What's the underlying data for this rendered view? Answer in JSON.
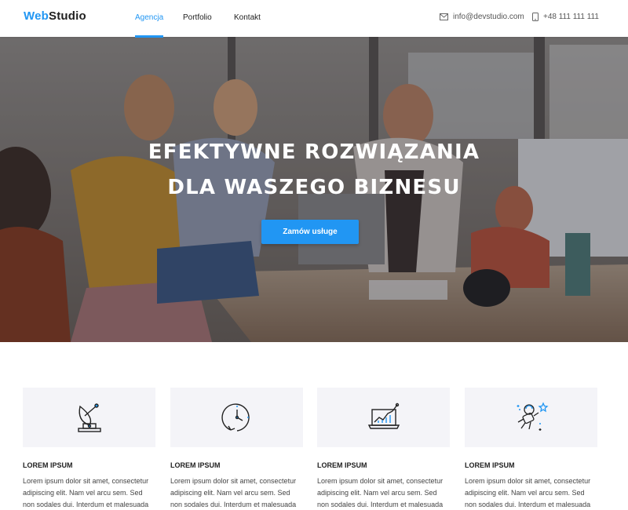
{
  "header": {
    "logo_part1": "Web",
    "logo_part2": "Studio",
    "nav": [
      {
        "label": "Agencja",
        "active": true
      },
      {
        "label": "Portfolio",
        "active": false
      },
      {
        "label": "Kontakt",
        "active": false
      }
    ],
    "email": "info@devstudio.com",
    "phone": "+48 111 111 111"
  },
  "hero": {
    "title_line1": "EFEKTYWNE ROZWIĄZANIA",
    "title_line2": "DLA WASZEGO BIZNESU",
    "cta_label": "Zamów usługe"
  },
  "features": [
    {
      "icon": "satellite-dish-icon",
      "title": "LOREM IPSUM",
      "lines": [
        "Lorem ipsum dolor sit amet, consectetur",
        "adipiscing elit. Nam vel arcu sem. Sed",
        "non sodales dui. Interdum et malesuada"
      ]
    },
    {
      "icon": "clock-icon",
      "title": "LOREM IPSUM",
      "lines": [
        "Lorem ipsum dolor sit amet, consectetur",
        "adipiscing elit. Nam vel arcu sem. Sed",
        "non sodales dui. Interdum et malesuada"
      ]
    },
    {
      "icon": "laptop-chart-icon",
      "title": "LOREM IPSUM",
      "lines": [
        "Lorem ipsum dolor sit amet, consectetur",
        "adipiscing elit. Nam vel arcu sem. Sed",
        "non sodales dui. Interdum et malesuada"
      ]
    },
    {
      "icon": "astronaut-icon",
      "title": "LOREM IPSUM",
      "lines": [
        "Lorem ipsum dolor sit amet, consectetur",
        "adipiscing elit. Nam vel arcu sem. Sed",
        "non sodales dui. Interdum et malesuada"
      ]
    }
  ],
  "colors": {
    "accent": "#2196f3",
    "text": "#212121",
    "feature_bg": "#f4f4f8"
  }
}
